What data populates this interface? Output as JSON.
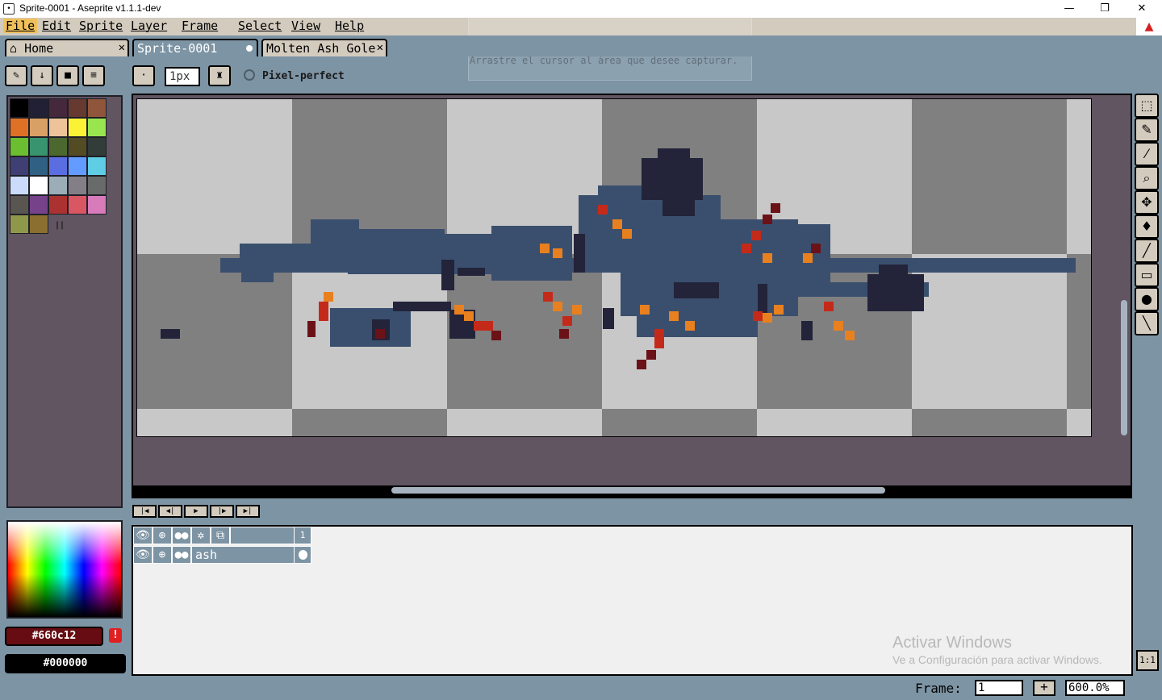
{
  "window": {
    "title": "Sprite-0001 - Aseprite v1.1.1-dev",
    "minimize": "—",
    "maximize": "❐",
    "close": "✕"
  },
  "menu": [
    "File",
    "Edit",
    "Sprite",
    "Layer",
    "Frame",
    "Select",
    "View",
    "Help"
  ],
  "tabs": [
    {
      "label": "Home",
      "close": "✕"
    },
    {
      "label": "Sprite-0001"
    },
    {
      "label": "Molten Ash Gole",
      "close": "✕"
    }
  ],
  "context_bar": {
    "brush_size": "1px",
    "pixel_perfect_label": "Pixel-perfect"
  },
  "palette": {
    "colors": [
      "#000000",
      "#222034",
      "#45283c",
      "#663931",
      "#8f563b",
      "#df7126",
      "#d9a066",
      "#eec39a",
      "#fbf236",
      "#99e550",
      "#6abe30",
      "#37946e",
      "#4b692f",
      "#524b24",
      "#323c39",
      "#3f3f74",
      "#306082",
      "#5b6ee1",
      "#639bff",
      "#5fcde4",
      "#cbdbfc",
      "#ffffff",
      "#9badb7",
      "#847e87",
      "#696a6a",
      "#595652",
      "#76428a",
      "#ac3232",
      "#d95763",
      "#d77bba",
      "#8f974a",
      "#8a6f30"
    ]
  },
  "colors": {
    "foreground_hex": "#660c12",
    "background_hex": "#000000",
    "warning": "!"
  },
  "tools": [
    "rectangular-marquee",
    "pencil",
    "eyedropper",
    "zoom",
    "move",
    "paint-bucket",
    "line",
    "rectangle",
    "contour",
    "blur"
  ],
  "timeline": {
    "frame_number": "1",
    "layer_name": "ash"
  },
  "watermark": {
    "title": "Activar Windows",
    "subtitle": "Ve a Configuración para activar Windows."
  },
  "status": {
    "frame_label": "Frame:",
    "frame_value": "1",
    "add_frame": "+",
    "zoom": "600.0%",
    "one_to_one": "1:1"
  },
  "overlay_hint": "Arrastre el cursor al área que desee capturar."
}
